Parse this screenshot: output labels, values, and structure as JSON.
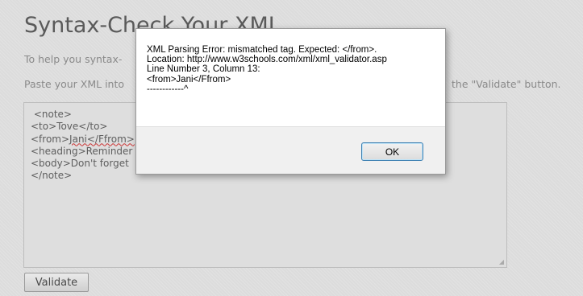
{
  "page": {
    "title": "Syntax-Check Your XML",
    "intro_line_1": "To help you syntax-",
    "intro_line_2": "Paste your XML into",
    "intro_line_2_tail": "the \"Validate\" button.",
    "xml_lines": [
      " <note>",
      "<to>Tove</to>",
      "<from>",
      "Jani</Ffrom>",
      "<heading>Reminder",
      "<body>Don't forget",
      "</note>"
    ],
    "validate_label": "Validate"
  },
  "dialog": {
    "message_lines": [
      "XML Parsing Error: mismatched tag. Expected: </from>.",
      "Location: http://www.w3schools.com/xml/xml_validator.asp",
      "Line Number 3, Column 13:",
      "<from>Jani</Ffrom>",
      "------------^"
    ],
    "ok_label": "OK"
  },
  "colors": {
    "page_background": "#dcdcdc",
    "title_text": "#5a5a5a",
    "muted_text": "#8a8a8a",
    "dialog_body": "#ffffff",
    "dialog_footer": "#f0f0f0",
    "ok_border": "#3c7fb1",
    "spellcheck_underline": "#cc3333"
  }
}
